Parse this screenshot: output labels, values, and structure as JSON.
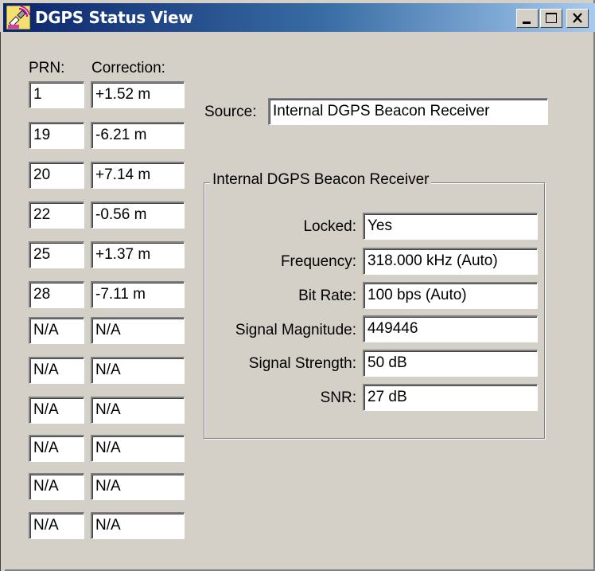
{
  "window": {
    "title": "DGPS Status View",
    "app_icon": "gps-satellite-app-icon",
    "controls": {
      "minimize_icon": "minimize-icon",
      "maximize_icon": "maximize-icon",
      "close_icon": "close-icon"
    }
  },
  "table": {
    "prn_header": "PRN:",
    "correction_header": "Correction:",
    "rows": [
      {
        "prn": "1",
        "correction": "+1.52 m"
      },
      {
        "prn": "19",
        "correction": "-6.21 m"
      },
      {
        "prn": "20",
        "correction": "+7.14 m"
      },
      {
        "prn": "22",
        "correction": "-0.56 m"
      },
      {
        "prn": "25",
        "correction": "+1.37 m"
      },
      {
        "prn": "28",
        "correction": "-7.11 m"
      },
      {
        "prn": "N/A",
        "correction": "N/A"
      },
      {
        "prn": "N/A",
        "correction": "N/A"
      },
      {
        "prn": "N/A",
        "correction": "N/A"
      },
      {
        "prn": "N/A",
        "correction": "N/A"
      },
      {
        "prn": "N/A",
        "correction": "N/A"
      },
      {
        "prn": "N/A",
        "correction": "N/A"
      }
    ]
  },
  "source": {
    "label": "Source:",
    "value": "Internal DGPS Beacon Receiver"
  },
  "receiver_group": {
    "title": "Internal DGPS Beacon Receiver",
    "fields": [
      {
        "label": "Locked:",
        "value": "Yes"
      },
      {
        "label": "Frequency:",
        "value": "318.000 kHz (Auto)"
      },
      {
        "label": "Bit Rate:",
        "value": "100 bps (Auto)"
      },
      {
        "label": "Signal Magnitude:",
        "value": "449446"
      },
      {
        "label": "Signal Strength:",
        "value": "50 dB"
      },
      {
        "label": "SNR:",
        "value": "27 dB"
      }
    ]
  },
  "colors": {
    "face": "#d4d0c8",
    "titlebar_start": "#0a246a",
    "titlebar_end": "#a6caf0"
  }
}
